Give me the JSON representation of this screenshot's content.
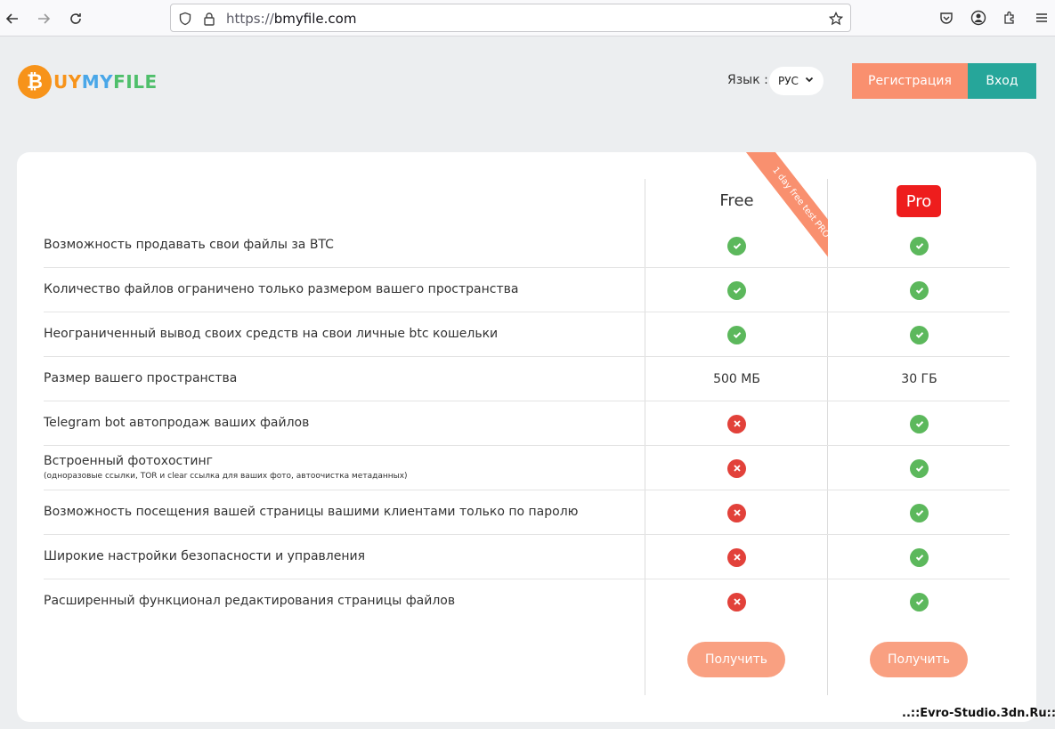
{
  "browser": {
    "url_scheme": "https://",
    "url_host": "bmyfile.com"
  },
  "header": {
    "logo_letter": "₿",
    "logo_text_a": "UY",
    "logo_text_b": "MY",
    "logo_text_c": "FILE",
    "lang_label": "Язык :",
    "lang_value": "РУС",
    "register_label": "Регистрация",
    "login_label": "Вход"
  },
  "plans": {
    "free_name": "Free",
    "pro_name": "Pro",
    "ribbon": "1 day free test PRO"
  },
  "features": [
    {
      "label": "Возможность продавать свои файлы за BTC",
      "free": "yes",
      "pro": "yes"
    },
    {
      "label": "Количество файлов ограничено только размером вашего пространства",
      "free": "yes",
      "pro": "yes"
    },
    {
      "label": "Неограниченный вывод своих средств на свои личные btc кошельки",
      "free": "yes",
      "pro": "yes"
    },
    {
      "label": "Размер вашего пространства",
      "free_text": "500 МБ",
      "pro_text": "30 ГБ"
    },
    {
      "label": "Telegram bot автопродаж ваших файлов",
      "free": "no",
      "pro": "yes"
    },
    {
      "label": "Встроенный фотохостинг",
      "note": "(одноразовые ссылки, TOR и clear ссылка для ваших фото, автоочистка метаданных)",
      "free": "no",
      "pro": "yes"
    },
    {
      "label": "Возможность посещения вашей страницы вашими клиентами только по паролю",
      "free": "no",
      "pro": "yes"
    },
    {
      "label": "Широкие настройки безопасности и управления",
      "free": "no",
      "pro": "yes"
    },
    {
      "label": "Расширенный функционал редактирования страницы файлов",
      "free": "no",
      "pro": "yes"
    }
  ],
  "actions": {
    "get_free_label": "Получить",
    "get_pro_label": "Получить"
  },
  "watermark": "..::Evro-Studio.3dn.Ru::..",
  "colors": {
    "accent_orange": "#f9906f",
    "teal": "#26a69a",
    "pro_red": "#ee1d1d",
    "check_green": "#5cb85c",
    "cross_red": "#e2413a"
  }
}
